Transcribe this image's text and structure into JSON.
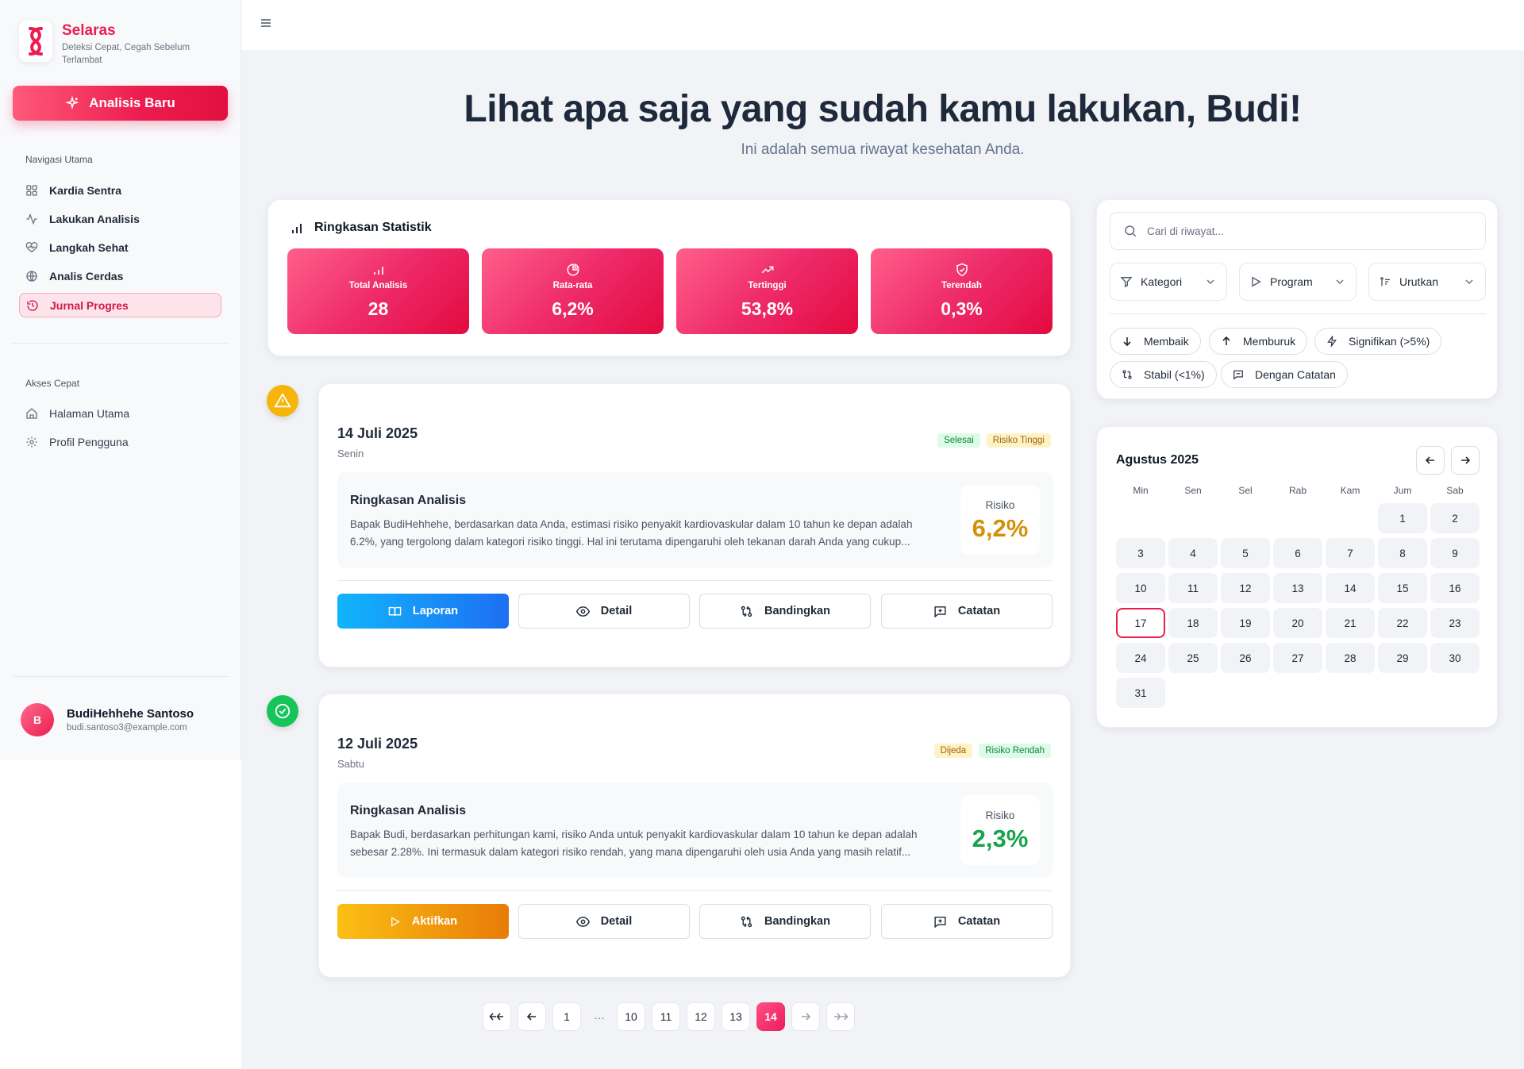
{
  "brand": {
    "name": "Selaras",
    "tagline": "Deteksi Cepat, Cegah Sebelum Terlambat",
    "accent": "#ec1c4f"
  },
  "sidebar": {
    "new_button": "Analisis Baru",
    "section_main": "Navigasi Utama",
    "main_items": [
      {
        "label": "Kardia Sentra",
        "icon": "dashboard-icon"
      },
      {
        "label": "Lakukan Analisis",
        "icon": "activity-icon"
      },
      {
        "label": "Langkah Sehat",
        "icon": "heart-pulse-icon"
      },
      {
        "label": "Analis Cerdas",
        "icon": "globe-icon"
      },
      {
        "label": "Jurnal Progres",
        "icon": "history-icon",
        "active": true
      }
    ],
    "section_quick": "Akses Cepat",
    "quick_items": [
      {
        "label": "Halaman Utama",
        "icon": "home-icon"
      },
      {
        "label": "Profil Pengguna",
        "icon": "gear-icon"
      }
    ]
  },
  "user": {
    "initial": "B",
    "name": "BudiHehhehe Santoso",
    "email": "budi.santoso3@example.com"
  },
  "hero": {
    "title": "Lihat apa saja yang sudah kamu lakukan, Budi!",
    "subtitle": "Ini adalah semua riwayat kesehatan Anda."
  },
  "stats": {
    "title": "Ringkasan Statistik",
    "tiles": [
      {
        "label": "Total Analisis",
        "value": "28",
        "icon": "bar-chart-icon"
      },
      {
        "label": "Rata-rata",
        "value": "6,2%",
        "icon": "pie-chart-icon"
      },
      {
        "label": "Tertinggi",
        "value": "53,8%",
        "icon": "trending-up-icon"
      },
      {
        "label": "Terendah",
        "value": "0,3%",
        "icon": "shield-check-icon"
      }
    ]
  },
  "entries": [
    {
      "date": "14 Juli 2025",
      "day": "Senin",
      "status_badge": "Selesai",
      "risk_badge": "Risiko Tinggi",
      "summary_title": "Ringkasan Analisis",
      "summary_text": "Bapak BudiHehhehe, berdasarkan data Anda, estimasi risiko penyakit kardiovaskular dalam 10 tahun ke depan adalah 6.2%, yang tergolong dalam kategori risiko tinggi. Hal ini terutama dipengaruhi oleh tekanan darah Anda yang cukup...",
      "risk_label": "Risiko",
      "risk_value": "6,2%",
      "risk_color": "#d4900a",
      "primary_action": "Laporan",
      "actions": [
        "Detail",
        "Bandingkan",
        "Catatan"
      ]
    },
    {
      "date": "12 Juli 2025",
      "day": "Sabtu",
      "status_badge": "Dijeda",
      "risk_badge": "Risiko Rendah",
      "summary_title": "Ringkasan Analisis",
      "summary_text": "Bapak Budi, berdasarkan perhitungan kami, risiko Anda untuk penyakit kardiovaskular dalam 10 tahun ke depan adalah sebesar 2.28%. Ini termasuk dalam kategori risiko rendah, yang mana dipengaruhi oleh usia Anda yang masih relatif...",
      "risk_label": "Risiko",
      "risk_value": "2,3%",
      "risk_color": "#16a34a",
      "primary_action": "Aktifkan",
      "actions": [
        "Detail",
        "Bandingkan",
        "Catatan"
      ]
    }
  ],
  "pagination": {
    "pages": [
      "1",
      "…",
      "10",
      "11",
      "12",
      "13",
      "14"
    ],
    "current": "14"
  },
  "filters": {
    "search_placeholder": "Cari di riwayat...",
    "dropdowns": [
      "Kategori",
      "Program",
      "Urutkan"
    ],
    "chips": [
      "Membaik",
      "Memburuk",
      "Signifikan (>5%)",
      "Stabil (<1%)",
      "Dengan Catatan"
    ]
  },
  "calendar": {
    "month": "Agustus 2025",
    "weekdays": [
      "Min",
      "Sen",
      "Sel",
      "Rab",
      "Kam",
      "Jum",
      "Sab"
    ],
    "days": [
      "1",
      "2",
      "3",
      "4",
      "5",
      "6",
      "7",
      "8",
      "9",
      "10",
      "11",
      "12",
      "13",
      "14",
      "15",
      "16",
      "17",
      "18",
      "19",
      "20",
      "21",
      "22",
      "23",
      "24",
      "25",
      "26",
      "27",
      "28",
      "29",
      "30",
      "31"
    ],
    "today": "17"
  },
  "colors": {
    "stat_gradient": [
      "#ff5f8a",
      "#e30a3f"
    ],
    "warning": "#f5b50a",
    "success": "#16c45a"
  }
}
